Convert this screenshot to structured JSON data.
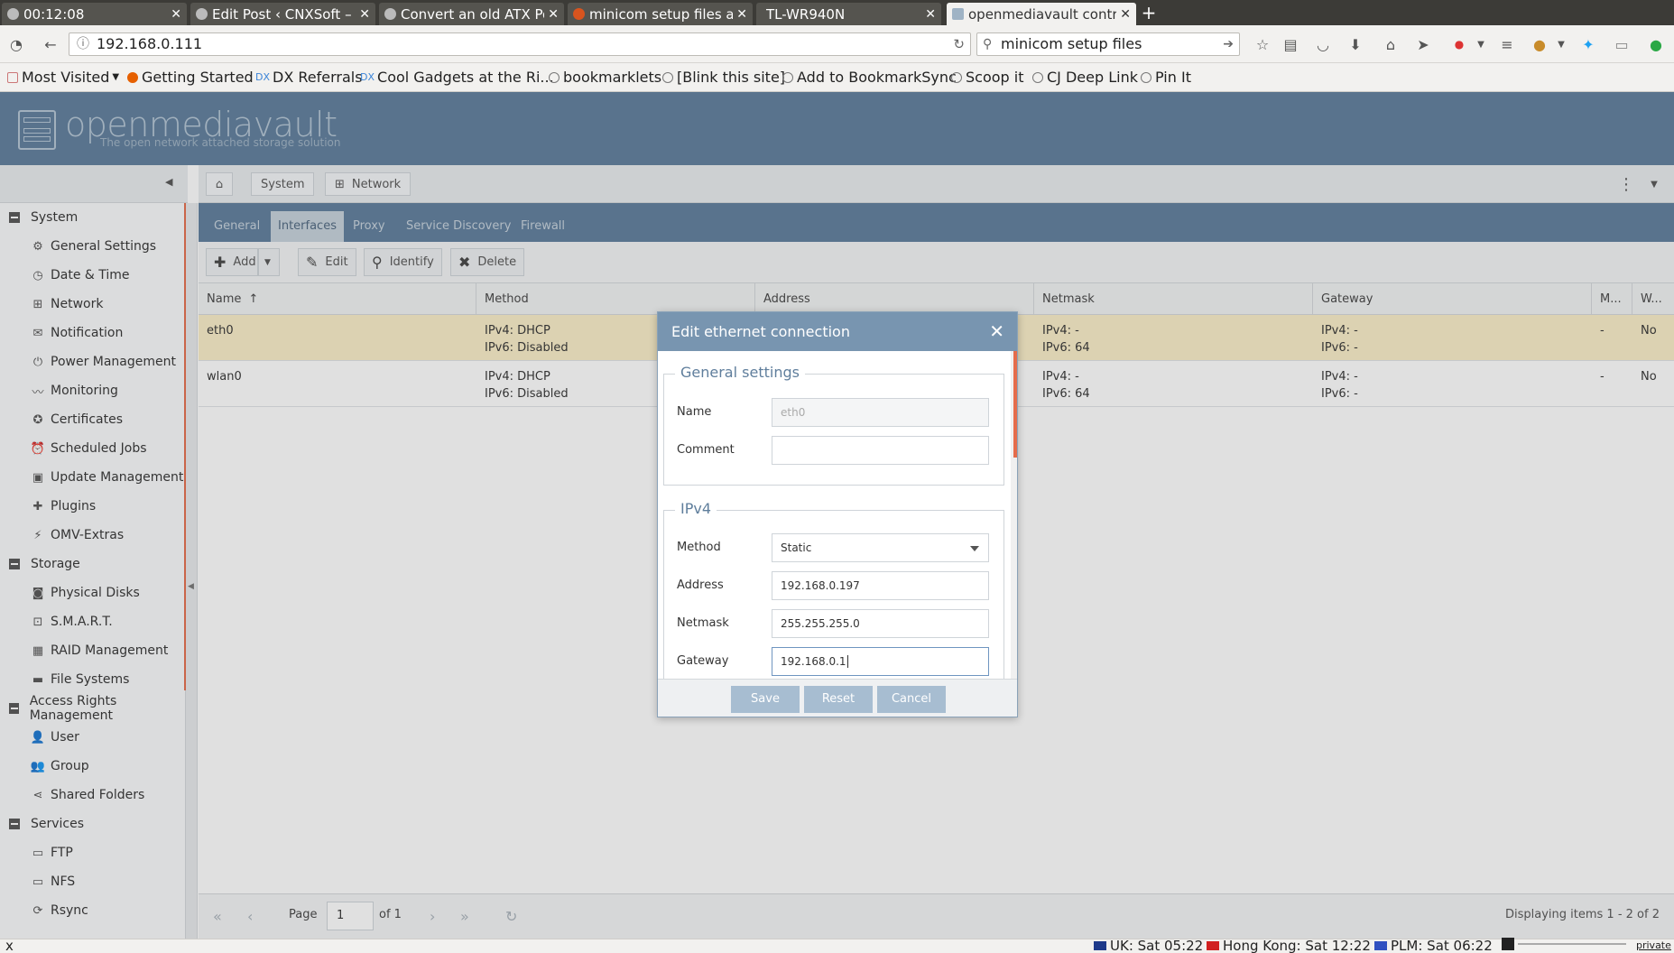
{
  "browser": {
    "tabs": [
      {
        "title": "00:12:08",
        "active": false
      },
      {
        "title": "Edit Post ‹ CNXSoft – E",
        "active": false
      },
      {
        "title": "Convert an old ATX Po",
        "active": false
      },
      {
        "title": "minicom setup files at",
        "active": false
      },
      {
        "title": "TL-WR940N",
        "active": false
      },
      {
        "title": "openmediavault contro",
        "active": true
      }
    ],
    "url": "192.168.0.111",
    "search_value": "minicom setup files",
    "bookmarks": [
      "Most Visited",
      "Getting Started",
      "DX Referrals",
      "Cool Gadgets at the Ri...",
      "bookmarklets",
      "[Blink this site]",
      "Add to BookmarkSync",
      "Scoop it",
      "CJ Deep Link",
      "Pin It"
    ]
  },
  "omv": {
    "logo": "openmediavault",
    "tagline": "The open network attached storage solution"
  },
  "breadcrumb": [
    "System",
    "Network"
  ],
  "page_tabs": [
    {
      "label": "General",
      "active": false
    },
    {
      "label": "Interfaces",
      "active": true
    },
    {
      "label": "Proxy",
      "active": false
    },
    {
      "label": "Service Discovery",
      "active": false
    },
    {
      "label": "Firewall",
      "active": false
    }
  ],
  "toolbar": {
    "add": "Add",
    "edit": "Edit",
    "identify": "Identify",
    "delete": "Delete"
  },
  "grid": {
    "columns": [
      "Name",
      "Method",
      "Address",
      "Netmask",
      "Gateway",
      "M...",
      "W..."
    ],
    "rows": [
      {
        "name": "eth0",
        "method": "IPv4: DHCP\nIPv6: Disabled",
        "address": "",
        "netmask": "IPv4: -\nIPv6: 64",
        "gateway": "IPv4: -\nIPv6: -",
        "m": "-",
        "w": "No",
        "selected": true
      },
      {
        "name": "wlan0",
        "method": "IPv4: DHCP\nIPv6: Disabled",
        "address": "",
        "netmask": "IPv4: -\nIPv6: 64",
        "gateway": "IPv4: -\nIPv6: -",
        "m": "-",
        "w": "No",
        "selected": false
      }
    ]
  },
  "pager": {
    "page_label": "Page",
    "page_value": "1",
    "of_label": "of 1",
    "display": "Displaying items 1 - 2 of 2"
  },
  "sidebar": {
    "groups": [
      {
        "label": "System",
        "items": [
          "General Settings",
          "Date & Time",
          "Network",
          "Notification",
          "Power Management",
          "Monitoring",
          "Certificates",
          "Scheduled Jobs",
          "Update Management",
          "Plugins",
          "OMV-Extras"
        ]
      },
      {
        "label": "Storage",
        "items": [
          "Physical Disks",
          "S.M.A.R.T.",
          "RAID Management",
          "File Systems"
        ]
      },
      {
        "label": "Access Rights Management",
        "items": [
          "User",
          "Group",
          "Shared Folders"
        ]
      },
      {
        "label": "Services",
        "items": [
          "FTP",
          "NFS",
          "Rsync"
        ]
      }
    ]
  },
  "dialog": {
    "title": "Edit ethernet connection",
    "general_legend": "General settings",
    "name_label": "Name",
    "name_value": "eth0",
    "comment_label": "Comment",
    "comment_value": "",
    "ipv4_legend": "IPv4",
    "method_label": "Method",
    "method_value": "Static",
    "address_label": "Address",
    "address_value": "192.168.0.197",
    "netmask_label": "Netmask",
    "netmask_value": "255.255.255.0",
    "gateway_label": "Gateway",
    "gateway_value": "192.168.0.1",
    "save": "Save",
    "reset": "Reset",
    "cancel": "Cancel"
  },
  "statusbar": {
    "close": "x",
    "uk": "UK: Sat 05:22",
    "hk": "Hong Kong: Sat 12:22",
    "plm": "PLM: Sat 06:22",
    "private": "private"
  },
  "colors": {
    "header": "#5f7e9c",
    "accent": "#e56c4b",
    "selected_row": "#fbefc9",
    "dialog_title": "#7895b0"
  }
}
